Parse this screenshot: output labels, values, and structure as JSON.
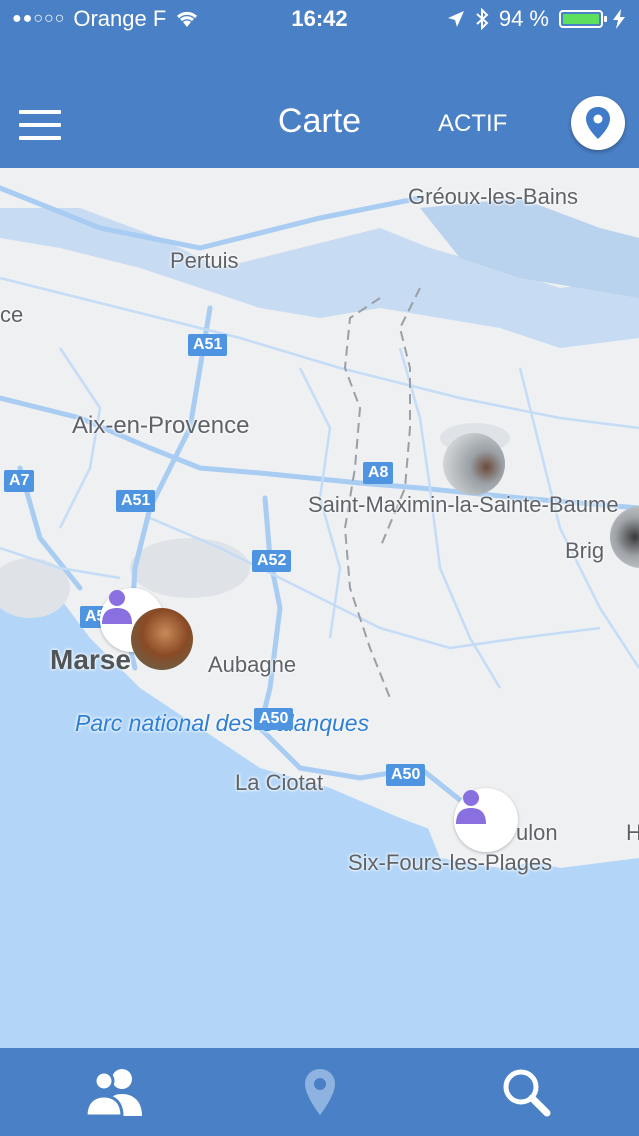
{
  "status": {
    "carrier": "Orange F",
    "time": "16:42",
    "battery": "94 %",
    "battery_level": 0.94
  },
  "header": {
    "title": "Carte",
    "actif_label": "ACTIF",
    "menu_icon": "hamburger-menu-icon",
    "location_icon": "map-pin-icon"
  },
  "map": {
    "places": {
      "greoux": "Gréoux-les-Bains",
      "pertuis": "Pertuis",
      "ce": "ce",
      "aix": "Aix-en-Provence",
      "saint_maximin": "Saint-Maximin-la-Sainte-Baume",
      "brig": "Brig",
      "marseille": "Marse",
      "aubagne": "Aubagne",
      "park": "Parc national des Calanques",
      "ciotat": "La Ciotat",
      "toulon": "ulon",
      "six_fours": "Six-Fours-les-Plages",
      "h": "H"
    },
    "roads": {
      "a51_top": "A51",
      "a51_mid": "A51",
      "a7": "A7",
      "a8": "A8",
      "a52": "A52",
      "a5": "A5",
      "a50_left": "A50",
      "a50_right": "A50"
    }
  },
  "tabbar": {
    "friends_icon": "friends-icon",
    "map_icon": "map-pin-icon",
    "search_icon": "search-icon"
  },
  "colors": {
    "primary": "#4a80c6",
    "accent_purple": "#8a6fe0",
    "water": "#b3d6f8",
    "road": "#a8ccf2"
  }
}
